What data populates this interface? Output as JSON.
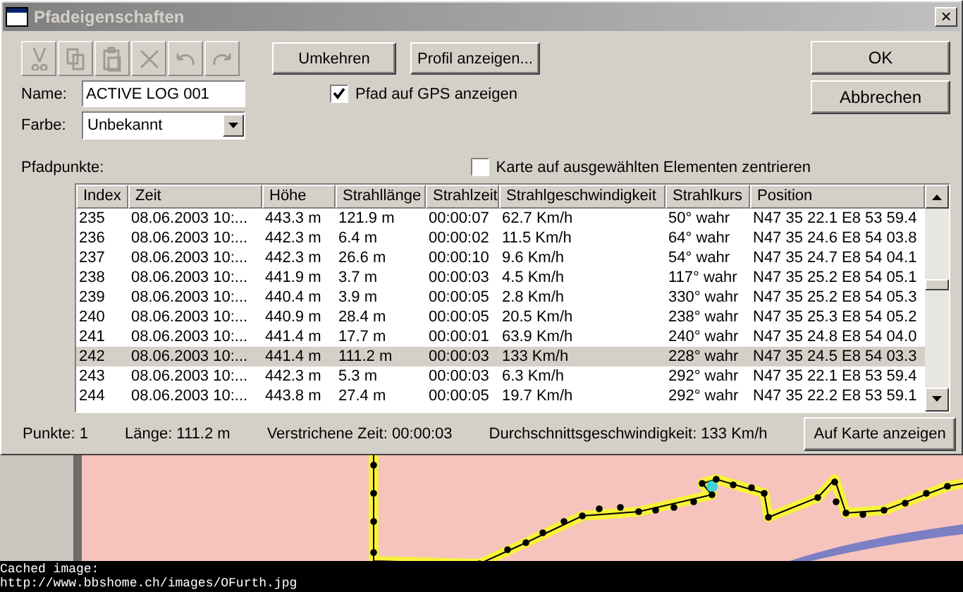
{
  "window": {
    "title": "Pfadeigenschaften",
    "close": "×"
  },
  "toolbar": [
    {
      "kind": "cut",
      "disabled": true
    },
    {
      "kind": "copy",
      "disabled": true
    },
    {
      "kind": "paste",
      "disabled": true
    },
    {
      "kind": "delete",
      "disabled": true
    },
    {
      "kind": "undo",
      "disabled": true
    },
    {
      "kind": "redo",
      "disabled": true
    }
  ],
  "buttons": {
    "reverse": "Umkehren",
    "profile": "Profil anzeigen...",
    "ok": "OK",
    "cancel": "Abbrechen",
    "show_on_map": "Auf Karte anzeigen"
  },
  "name": {
    "label": "Name:",
    "value": "ACTIVE LOG 001"
  },
  "color": {
    "label": "Farbe:",
    "value": "Unbekannt"
  },
  "show_on_gps": {
    "label": "Pfad auf GPS anzeigen",
    "checked": true
  },
  "center_map": {
    "label": "Karte auf ausgewählten Elementen zentrieren",
    "checked": false
  },
  "points_label": "Pfadpunkte:",
  "table": {
    "columns": [
      "Index",
      "Zeit",
      "Höhe",
      "Strahllänge",
      "Strahlzeit",
      "Strahlgeschwindigkeit",
      "Strahlkurs",
      "Position"
    ],
    "rows": [
      {
        "cells": [
          "235",
          "08.06.2003 10:...",
          "443.3 m",
          "121.9 m",
          "00:00:07",
          "62.7 Km/h",
          "50° wahr",
          "N47 35 22.1 E8 53 59.4"
        ],
        "selected": false
      },
      {
        "cells": [
          "236",
          "08.06.2003 10:...",
          "442.3 m",
          "6.4 m",
          "00:00:02",
          "11.5 Km/h",
          "64° wahr",
          "N47 35 24.6 E8 54 03.8"
        ],
        "selected": false
      },
      {
        "cells": [
          "237",
          "08.06.2003 10:...",
          "442.3 m",
          "26.6 m",
          "00:00:10",
          "9.6 Km/h",
          "54° wahr",
          "N47 35 24.7 E8 54 04.1"
        ],
        "selected": false
      },
      {
        "cells": [
          "238",
          "08.06.2003 10:...",
          "441.9 m",
          "3.7 m",
          "00:00:03",
          "4.5 Km/h",
          "117° wahr",
          "N47 35 25.2 E8 54 05.1"
        ],
        "selected": false
      },
      {
        "cells": [
          "239",
          "08.06.2003 10:...",
          "440.4 m",
          "3.9 m",
          "00:00:05",
          "2.8 Km/h",
          "330° wahr",
          "N47 35 25.2 E8 54 05.3"
        ],
        "selected": false
      },
      {
        "cells": [
          "240",
          "08.06.2003 10:...",
          "440.9 m",
          "28.4 m",
          "00:00:05",
          "20.5 Km/h",
          "238° wahr",
          "N47 35 25.3 E8 54 05.2"
        ],
        "selected": false
      },
      {
        "cells": [
          "241",
          "08.06.2003 10:...",
          "441.4 m",
          "17.7 m",
          "00:00:01",
          "63.9 Km/h",
          "240° wahr",
          "N47 35 24.8 E8 54 04.0"
        ],
        "selected": false
      },
      {
        "cells": [
          "242",
          "08.06.2003 10:...",
          "441.4 m",
          "111.2 m",
          "00:00:03",
          "133 Km/h",
          "228° wahr",
          "N47 35 24.5 E8 54 03.3"
        ],
        "selected": true
      },
      {
        "cells": [
          "243",
          "08.06.2003 10:...",
          "442.3 m",
          "5.3 m",
          "00:00:03",
          "6.3 Km/h",
          "292° wahr",
          "N47 35 22.1 E8 53 59.4"
        ],
        "selected": false
      },
      {
        "cells": [
          "244",
          "08.06.2003 10:...",
          "443.8 m",
          "27.4 m",
          "00:00:05",
          "19.7 Km/h",
          "292° wahr",
          "N47 35 22.2 E8 53 59.1"
        ],
        "selected": false
      }
    ]
  },
  "stats": [
    "Punkte: 1",
    "Länge: 111.2 m",
    "Verstrichene Zeit: 00:00:03",
    "Durchschnittsgeschwindigkeit: 133 Km/h"
  ],
  "caption": [
    "Cached image:",
    "http://www.bbshome.ch/images/OFurth.jpg"
  ]
}
